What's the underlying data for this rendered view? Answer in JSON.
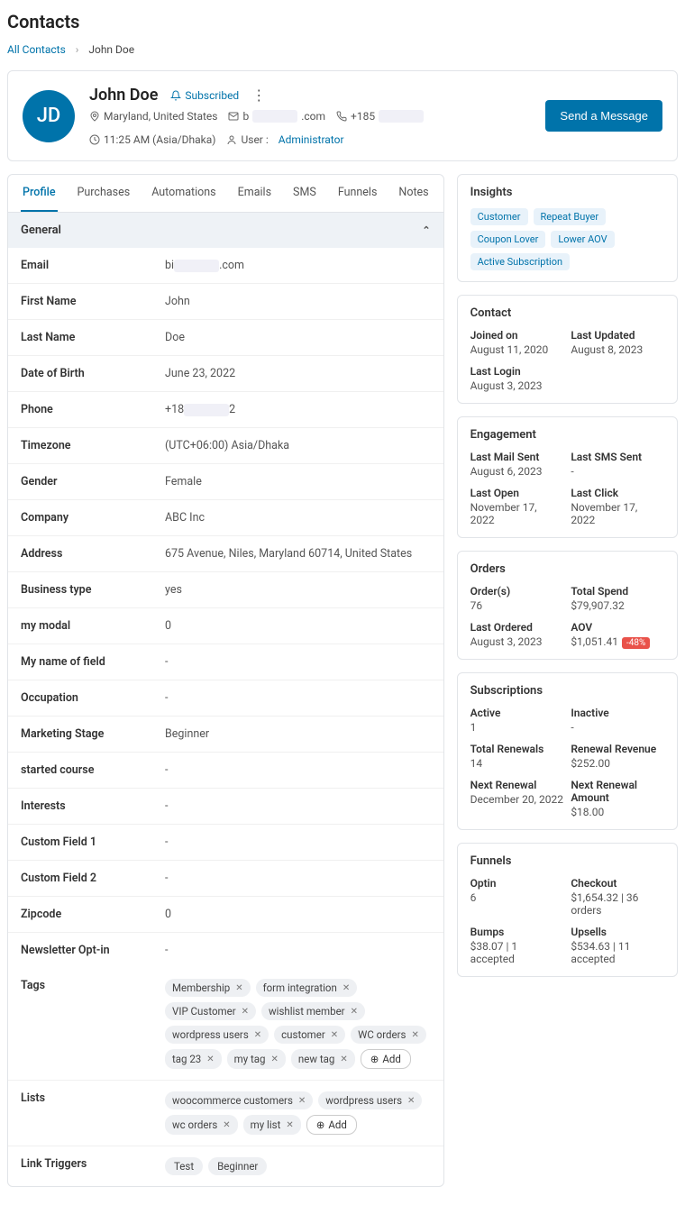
{
  "page_title": "Contacts",
  "breadcrumb": {
    "all": "All Contacts",
    "current": "John Doe"
  },
  "header": {
    "initials": "JD",
    "name": "John Doe",
    "subscribed": "Subscribed",
    "location": "Maryland, United States",
    "email_prefix": "b",
    "email_suffix": ".com",
    "phone_prefix": "+185",
    "time": "11:25 AM (Asia/Dhaka)",
    "user_label": "User :",
    "user_value": "Administrator",
    "send_button": "Send a Message"
  },
  "tabs": [
    "Profile",
    "Purchases",
    "Automations",
    "Emails",
    "SMS",
    "Funnels",
    "Notes"
  ],
  "general": {
    "title": "General",
    "fields": [
      {
        "label": "Email",
        "prefix": "bi",
        "suffix": ".com",
        "redacted": true
      },
      {
        "label": "First Name",
        "value": "John"
      },
      {
        "label": "Last Name",
        "value": "Doe"
      },
      {
        "label": "Date of Birth",
        "value": "June 23, 2022"
      },
      {
        "label": "Phone",
        "prefix": "+18",
        "suffix": "2",
        "redacted": true
      },
      {
        "label": "Timezone",
        "value": "(UTC+06:00) Asia/Dhaka"
      },
      {
        "label": "Gender",
        "value": "Female"
      },
      {
        "label": "Company",
        "value": "ABC Inc"
      },
      {
        "label": "Address",
        "value": "675 Avenue, Niles, Maryland 60714, United States"
      },
      {
        "label": "Business type",
        "value": "yes"
      },
      {
        "label": "my modal",
        "value": "0"
      },
      {
        "label": "My name of field",
        "value": "-"
      },
      {
        "label": "Occupation",
        "value": "-"
      },
      {
        "label": "Marketing Stage",
        "value": "Beginner"
      },
      {
        "label": "started course",
        "value": "-"
      },
      {
        "label": "Interests",
        "value": "-"
      },
      {
        "label": "Custom Field 1",
        "value": "-"
      },
      {
        "label": "Custom Field 2",
        "value": "-"
      },
      {
        "label": "Zipcode",
        "value": "0"
      },
      {
        "label": "Newsletter Opt-in",
        "value": "-"
      }
    ],
    "tags_label": "Tags",
    "tags": [
      "Membership",
      "form integration",
      "VIP Customer",
      "wishlist member",
      "wordpress users",
      "customer",
      "WC orders",
      "tag 23",
      "my tag",
      "new tag"
    ],
    "add_label": "Add",
    "lists_label": "Lists",
    "lists": [
      "woocommerce customers",
      "wordpress users",
      "wc orders",
      "my list"
    ],
    "link_triggers_label": "Link Triggers",
    "link_triggers": [
      "Test",
      "Beginner"
    ]
  },
  "insights": {
    "title": "Insights",
    "tags": [
      "Customer",
      "Repeat Buyer",
      "Coupon Lover",
      "Lower AOV",
      "Active Subscription"
    ]
  },
  "contact_panel": {
    "title": "Contact",
    "items": [
      {
        "label": "Joined on",
        "value": "August 11, 2020"
      },
      {
        "label": "Last Updated",
        "value": "August 8, 2023"
      },
      {
        "label": "Last Login",
        "value": "August 3, 2023"
      }
    ]
  },
  "engagement": {
    "title": "Engagement",
    "items": [
      {
        "label": "Last Mail Sent",
        "value": "August 6, 2023"
      },
      {
        "label": "Last SMS Sent",
        "value": "-"
      },
      {
        "label": "Last Open",
        "value": "November 17, 2022"
      },
      {
        "label": "Last Click",
        "value": "November 17, 2022"
      }
    ]
  },
  "orders": {
    "title": "Orders",
    "items": [
      {
        "label": "Order(s)",
        "value": "76"
      },
      {
        "label": "Total Spend",
        "value": "$79,907.32"
      },
      {
        "label": "Last Ordered",
        "value": "August 3, 2023"
      },
      {
        "label": "AOV",
        "value": "$1,051.41",
        "badge": "-48%"
      }
    ]
  },
  "subscriptions": {
    "title": "Subscriptions",
    "items": [
      {
        "label": "Active",
        "value": "1"
      },
      {
        "label": "Inactive",
        "value": "-"
      },
      {
        "label": "Total Renewals",
        "value": "14"
      },
      {
        "label": "Renewal Revenue",
        "value": "$252.00"
      },
      {
        "label": "Next Renewal",
        "value": "December 20, 2022"
      },
      {
        "label": "Next Renewal Amount",
        "value": "$18.00"
      }
    ]
  },
  "funnels": {
    "title": "Funnels",
    "items": [
      {
        "label": "Optin",
        "value": "6"
      },
      {
        "label": "Checkout",
        "value": "$1,654.32 | 36 orders"
      },
      {
        "label": "Bumps",
        "value": "$38.07 | 1 accepted"
      },
      {
        "label": "Upsells",
        "value": "$534.63 | 11 accepted"
      }
    ]
  }
}
